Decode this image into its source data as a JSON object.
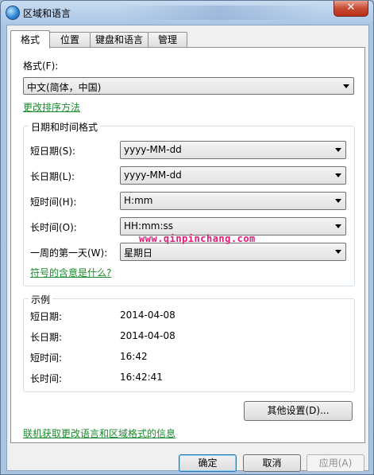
{
  "window": {
    "title": "区域和语言",
    "close_label": "✕"
  },
  "tabs": [
    {
      "label": "格式",
      "active": true
    },
    {
      "label": "位置",
      "active": false
    },
    {
      "label": "键盘和语言",
      "active": false
    },
    {
      "label": "管理",
      "active": false
    }
  ],
  "format": {
    "label": "格式(F):",
    "value": "中文(简体，中国)",
    "sort_link": "更改排序方法"
  },
  "datetime": {
    "group_title": "日期和时间格式",
    "short_date": {
      "label": "短日期(S):",
      "value": "yyyy-MM-dd"
    },
    "long_date": {
      "label": "长日期(L):",
      "value": "yyyy-MM-dd"
    },
    "short_time": {
      "label": "短时间(H):",
      "value": "H:mm"
    },
    "long_time": {
      "label": "长时间(O):",
      "value": "HH:mm:ss"
    },
    "first_day": {
      "label": "一周的第一天(W):",
      "value": "星期日"
    },
    "symbols_link": "符号的含意是什么?"
  },
  "watermark": "www.qinpinchang.com",
  "examples": {
    "group_title": "示例",
    "short_date": {
      "label": "短日期:",
      "value": "2014-04-08"
    },
    "long_date": {
      "label": "长日期:",
      "value": "2014-04-08"
    },
    "short_time": {
      "label": "短时间:",
      "value": "16:42"
    },
    "long_time": {
      "label": "长时间:",
      "value": "16:42:41"
    }
  },
  "other_settings_label": "其他设置(D)...",
  "online_link": "联机获取更改语言和区域格式的信息",
  "buttons": {
    "ok": "确定",
    "cancel": "取消",
    "apply": "应用(A)"
  }
}
